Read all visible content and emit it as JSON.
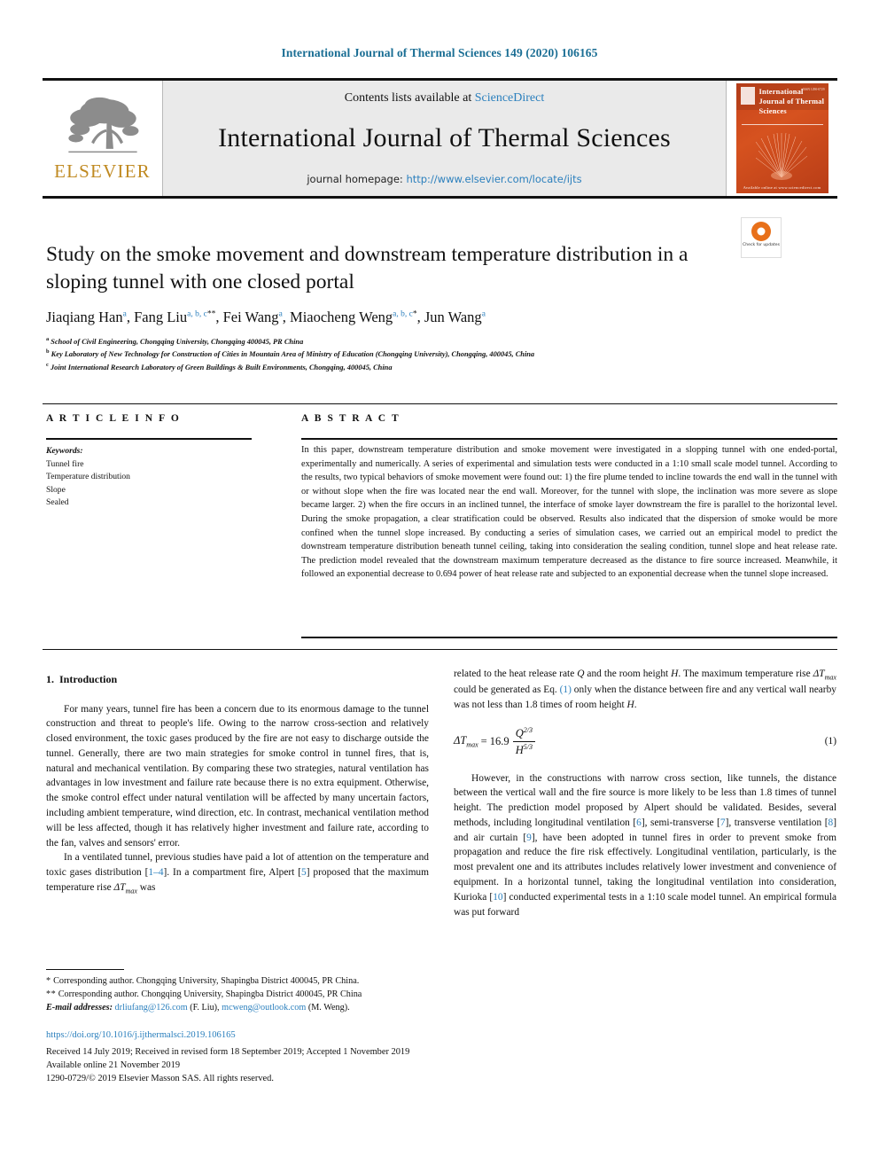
{
  "running_head": "International Journal of Thermal Sciences 149 (2020) 106165",
  "masthead": {
    "publisher_name": "ELSEVIER",
    "contents_prefix": "Contents lists available at ",
    "contents_link": "ScienceDirect",
    "journal_title": "International Journal of Thermal Sciences",
    "homepage_prefix": "journal homepage: ",
    "homepage_url": "http://www.elsevier.com/locate/ijts",
    "cover": {
      "title": "International Journal of Thermal Sciences",
      "footer": "Available online at www.sciencedirect.com",
      "code": "ISSN 1290-0729"
    }
  },
  "crossmark": {
    "label": "Check for updates"
  },
  "article": {
    "title": "Study on the smoke movement and downstream temperature distribution in a sloping tunnel with one closed portal",
    "authors": [
      {
        "name": "Jiaqiang Han",
        "affils": "a",
        "marks": ""
      },
      {
        "name": "Fang Liu",
        "affils": "a, b, c",
        "marks": "**"
      },
      {
        "name": "Fei Wang",
        "affils": "a",
        "marks": ""
      },
      {
        "name": "Miaocheng Weng",
        "affils": "a, b, c",
        "marks": "*"
      },
      {
        "name": "Jun Wang",
        "affils": "a",
        "marks": ""
      }
    ],
    "affiliations": [
      {
        "label": "a",
        "text": "School of Civil Engineering, Chongqing University, Chongqing 400045, PR China"
      },
      {
        "label": "b",
        "text": "Key Laboratory of New Technology for Construction of Cities in Mountain Area of Ministry of Education (Chongqing University), Chongqing, 400045, China"
      },
      {
        "label": "c",
        "text": "Joint International Research Laboratory of Green Buildings & Built Environments, Chongqing, 400045, China"
      }
    ]
  },
  "article_info": {
    "heading": "A R T I C L E  I N F O",
    "keywords_label": "Keywords:",
    "keywords": [
      "Tunnel fire",
      "Temperature distribution",
      "Slope",
      "Sealed"
    ]
  },
  "abstract": {
    "heading": "A B S T R A C T",
    "text": "In this paper, downstream temperature distribution and smoke movement were investigated in a slopping tunnel with one ended-portal, experimentally and numerically. A series of experimental and simulation tests were conducted in a 1:10 small scale model tunnel. According to the results, two typical behaviors of smoke movement were found out: 1) the fire plume tended to incline towards the end wall in the tunnel with or without slope when the fire was located near the end wall. Moreover, for the tunnel with slope, the inclination was more severe as slope became larger. 2) when the fire occurs in an inclined tunnel, the interface of smoke layer downstream the fire is parallel to the horizontal level. During the smoke propagation, a clear stratification could be observed. Results also indicated that the dispersion of smoke would be more confined when the tunnel slope increased. By conducting a series of simulation cases, we carried out an empirical model to predict the downstream temperature distribution beneath tunnel ceiling, taking into consideration the sealing condition, tunnel slope and heat release rate. The prediction model revealed that the downstream maximum temperature decreased as the distance to fire source increased. Meanwhile, it followed an exponential decrease to 0.694 power of heat release rate and subjected to an exponential decrease when the tunnel slope increased."
  },
  "body": {
    "section_number": "1.",
    "section_title": "Introduction",
    "left_p1": "For many years, tunnel fire has been a concern due to its enormous damage to the tunnel construction and threat to people's life. Owing to the narrow cross-section and relatively closed environment, the toxic gases produced by the fire are not easy to discharge outside the tunnel. Generally, there are two main strategies for smoke control in tunnel fires, that is, natural and mechanical ventilation. By comparing these two strategies, natural ventilation has advantages in low investment and failure rate because there is no extra equipment. Otherwise, the smoke control effect under natural ventilation will be affected by many uncertain factors, including ambient temperature, wind direction, etc. In contrast, mechanical ventilation method will be less affected, though it has relatively higher investment and failure rate, according to the fan, valves and sensors' error.",
    "left_p2_a": "In a ventilated tunnel, previous studies have paid a lot of attention on the temperature and toxic gases distribution [",
    "left_p2_ref1": "1–4",
    "left_p2_b": "]. In a compartment fire, Alpert [",
    "left_p2_ref2": "5",
    "left_p2_c": "] proposed that the maximum temperature rise ",
    "left_p2_d": " was",
    "right_p1_a": "related to the heat release rate ",
    "right_p1_b": " and the room height ",
    "right_p1_c": ". The maximum temperature rise ",
    "right_p1_d": " could be generated as Eq. ",
    "right_p1_ref": "(1)",
    "right_p1_e": " only when the distance between fire and any vertical wall nearby was not less than 1.8 times of room height ",
    "right_p1_f": ".",
    "equation": {
      "lhs": "ΔT",
      "lhs_sub": "max",
      "equals": "= 16.9",
      "numerator": "Q",
      "numerator_exp": "2/3",
      "denominator": "H",
      "denominator_exp": "5/3",
      "number": "(1)"
    },
    "right_p2_a": "However, in the constructions with narrow cross section, like tunnels, the distance between the vertical wall and the fire source is more likely to be less than 1.8 times of tunnel height. The prediction model proposed by Alpert should be validated. Besides, several methods, including longitudinal ventilation [",
    "right_p2_ref6": "6",
    "right_p2_b": "], semi-transverse [",
    "right_p2_ref7": "7",
    "right_p2_c": "], transverse ventilation [",
    "right_p2_ref8": "8",
    "right_p2_d": "] and air curtain [",
    "right_p2_ref9": "9",
    "right_p2_e": "], have been adopted in tunnel fires in order to prevent smoke from propagation and reduce the fire risk effectively. Longitudinal ventilation, particularly, is the most prevalent one and its attributes includes relatively lower investment and convenience of equipment. In a horizontal tunnel, taking the longitudinal ventilation into consideration, Kurioka [",
    "right_p2_ref10": "10",
    "right_p2_f": "] conducted experimental tests in a 1:10 scale model tunnel. An empirical formula was put forward"
  },
  "footnotes": {
    "fn1_star": "*",
    "fn1_text": " Corresponding author. Chongqing University, Shapingba District 400045, PR China.",
    "fn2_star": "**",
    "fn2_text": " Corresponding author. Chongqing University, Shapingba District 400045, PR China",
    "email_label": "E-mail addresses:",
    "email1": "drliufang@126.com",
    "email1_owner": " (F. Liu), ",
    "email2": "mcweng@outlook.com",
    "email2_owner": " (M. Weng)."
  },
  "publication": {
    "doi": "https://doi.org/10.1016/j.ijthermalsci.2019.106165",
    "received": "Received 14 July 2019; Received in revised form 18 September 2019; Accepted 1 November 2019",
    "available": "Available online 21 November 2019",
    "copyright": "1290-0729/© 2019 Elsevier Masson SAS. All rights reserved."
  },
  "colors": {
    "link": "#2a7fbd",
    "running_head": "#1a6e94",
    "elsevier_orange": "#c08a22",
    "cover_red": "#c8441b"
  }
}
